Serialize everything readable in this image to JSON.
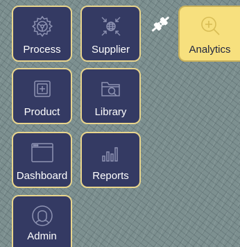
{
  "tiles": {
    "process": {
      "label": "Process",
      "icon": "gear-icon"
    },
    "supplier": {
      "label": "Supplier",
      "icon": "globe-network-icon"
    },
    "analytics": {
      "label": "Analytics",
      "icon": "zoom-in-icon",
      "state": "highlighted"
    },
    "product": {
      "label": "Product",
      "icon": "add-box-icon"
    },
    "library": {
      "label": "Library",
      "icon": "folder-search-icon"
    },
    "dashboard": {
      "label": "Dashboard",
      "icon": "browser-window-icon"
    },
    "reports": {
      "label": "Reports",
      "icon": "bar-chart-icon"
    },
    "admin": {
      "label": "Admin",
      "icon": "user-icon"
    }
  },
  "connector": {
    "icon": "plug-icon"
  },
  "colors": {
    "background": "#7d9090",
    "tile_fill": "#343a63",
    "tile_border": "#e9d58c",
    "highlight_fill": "#f7e07e",
    "icon_stroke": "#8e93b3"
  }
}
